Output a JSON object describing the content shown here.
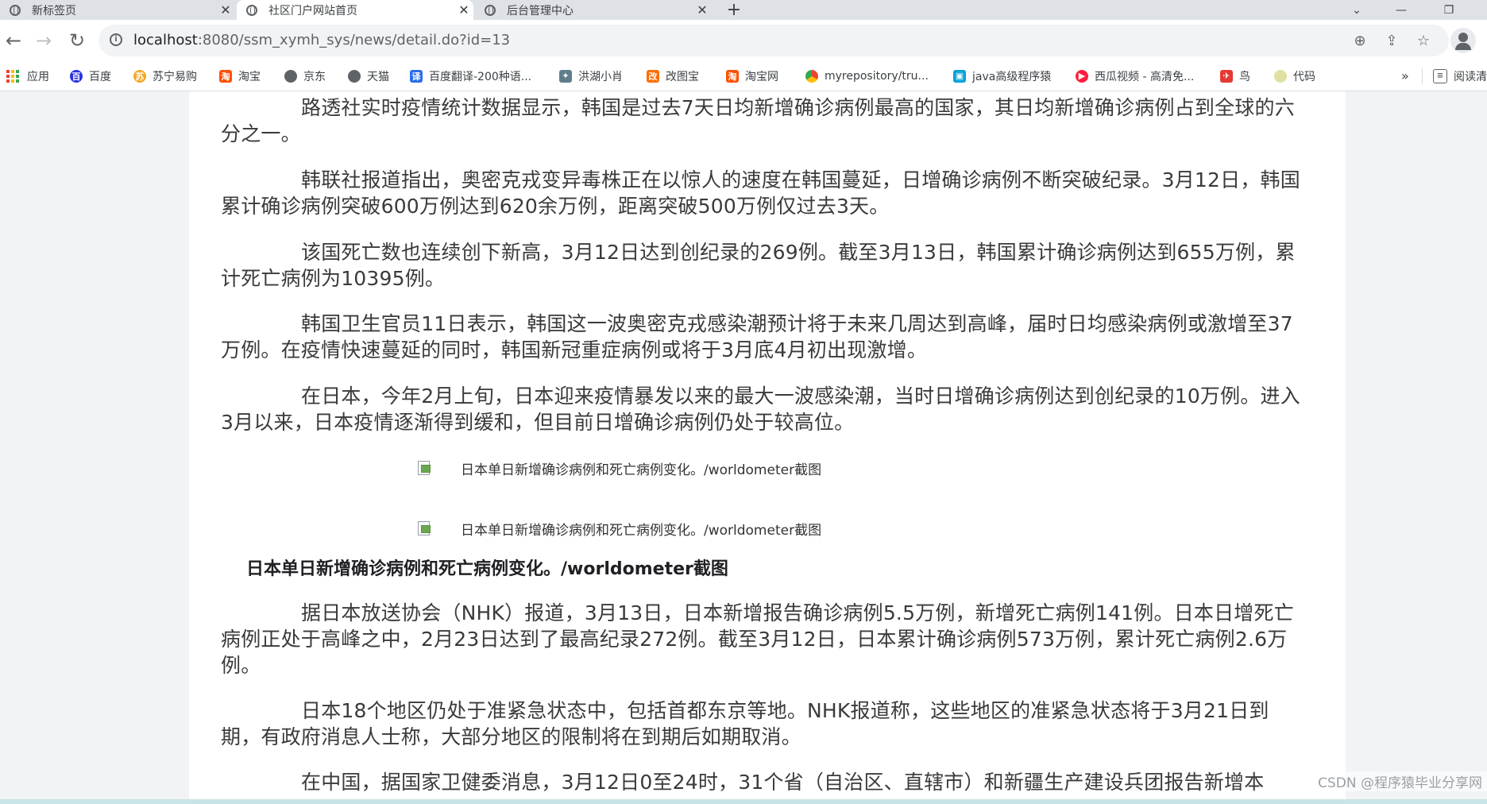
{
  "tabs": [
    {
      "title": "新标签页",
      "active": false
    },
    {
      "title": "社区门户网站首页",
      "active": true
    },
    {
      "title": "后台管理中心",
      "active": false
    }
  ],
  "toolbar": {
    "url_host": "localhost",
    "url_rest": ":8080/ssm_xymh_sys/news/detail.do?id=13"
  },
  "bookmarks": [
    {
      "label": "应用",
      "icon": "apps-icon",
      "color": "#1a73e8"
    },
    {
      "label": "百度",
      "icon": "baidu-icon",
      "color": "#2932e1"
    },
    {
      "label": "苏宁易购",
      "icon": "suning-icon",
      "color": "#f5a623"
    },
    {
      "label": "淘宝",
      "icon": "taobao-icon",
      "color": "#ff5000"
    },
    {
      "label": "京东",
      "icon": "globe-icon",
      "color": "#5f6368"
    },
    {
      "label": "天猫",
      "icon": "globe-icon",
      "color": "#5f6368"
    },
    {
      "label": "百度翻译-200种语...",
      "icon": "translate-icon",
      "color": "#2b6de8"
    },
    {
      "label": "洪湖小肖",
      "icon": "bird-icon",
      "color": "#607d8b"
    },
    {
      "label": "改图宝",
      "icon": "gaitubao-icon",
      "color": "#ff6d00"
    },
    {
      "label": "淘宝网",
      "icon": "taobao-icon",
      "color": "#ff5000"
    },
    {
      "label": "myrepository/tru...",
      "icon": "chrome-icon",
      "color": "#34a853"
    },
    {
      "label": "java高级程序猿",
      "icon": "bilibili-icon",
      "color": "#00a1d6"
    },
    {
      "label": "西瓜视频 - 高清免...",
      "icon": "xigua-icon",
      "color": "#ff1e3c"
    },
    {
      "label": "鸟",
      "icon": "bird-icon",
      "color": "#e53935"
    },
    {
      "label": "代码",
      "icon": "code-icon",
      "color": "#e0e0a0"
    }
  ],
  "bookmarks_more": "»",
  "reading_list": "阅读清",
  "article": {
    "paragraphs": [
      "路透社实时疫情统计数据显示，韩国是过去7天日均新增确诊病例最高的国家，其日均新增确诊病例占到全球的六分之一。",
      "韩联社报道指出，奥密克戎变异毒株正在以惊人的速度在韩国蔓延，日增确诊病例不断突破纪录。3月12日，韩国累计确诊病例突破600万例达到620余万例，距离突破500万例仅过去3天。",
      "该国死亡数也连续创下新高，3月12日达到创纪录的269例。截至3月13日，韩国累计确诊病例达到655万例，累计死亡病例为10395例。",
      "韩国卫生官员11日表示，韩国这一波奥密克戎感染潮预计将于未来几周达到高峰，届时日均感染病例或激增至37万例。在疫情快速蔓延的同时，韩国新冠重症病例或将于3月底4月初出现激增。",
      "在日本，今年2月上旬，日本迎来疫情暴发以来的最大一波感染潮，当时日增确诊病例达到创纪录的10万例。进入3月以来，日本疫情逐渐得到缓和，但目前日增确诊病例仍处于较高位。"
    ],
    "image_alts": [
      "日本单日新增确诊病例和死亡病例变化。/worldometer截图",
      "日本单日新增确诊病例和死亡病例变化。/worldometer截图"
    ],
    "caption": "日本单日新增确诊病例和死亡病例变化。/worldometer截图",
    "paragraphs_after": [
      "据日本放送协会（NHK）报道，3月13日，日本新增报告确诊病例5.5万例，新增死亡病例141例。日本日增死亡病例正处于高峰之中，2月23日达到了最高纪录272例。截至3月12日，日本累计确诊病例573万例，累计死亡病例2.6万例。",
      "日本18个地区仍处于准紧急状态中，包括首都东京等地。NHK报道称，这些地区的准紧急状态将于3月21日到期，有政府消息人士称，大部分地区的限制将在到期后如期取消。",
      "在中国，据国家卫健委消息，3月12日0至24时，31个省（自治区、直辖市）和新疆生产建设兵团报告新增本"
    ]
  },
  "watermark": "CSDN @程序猿毕业分享网"
}
